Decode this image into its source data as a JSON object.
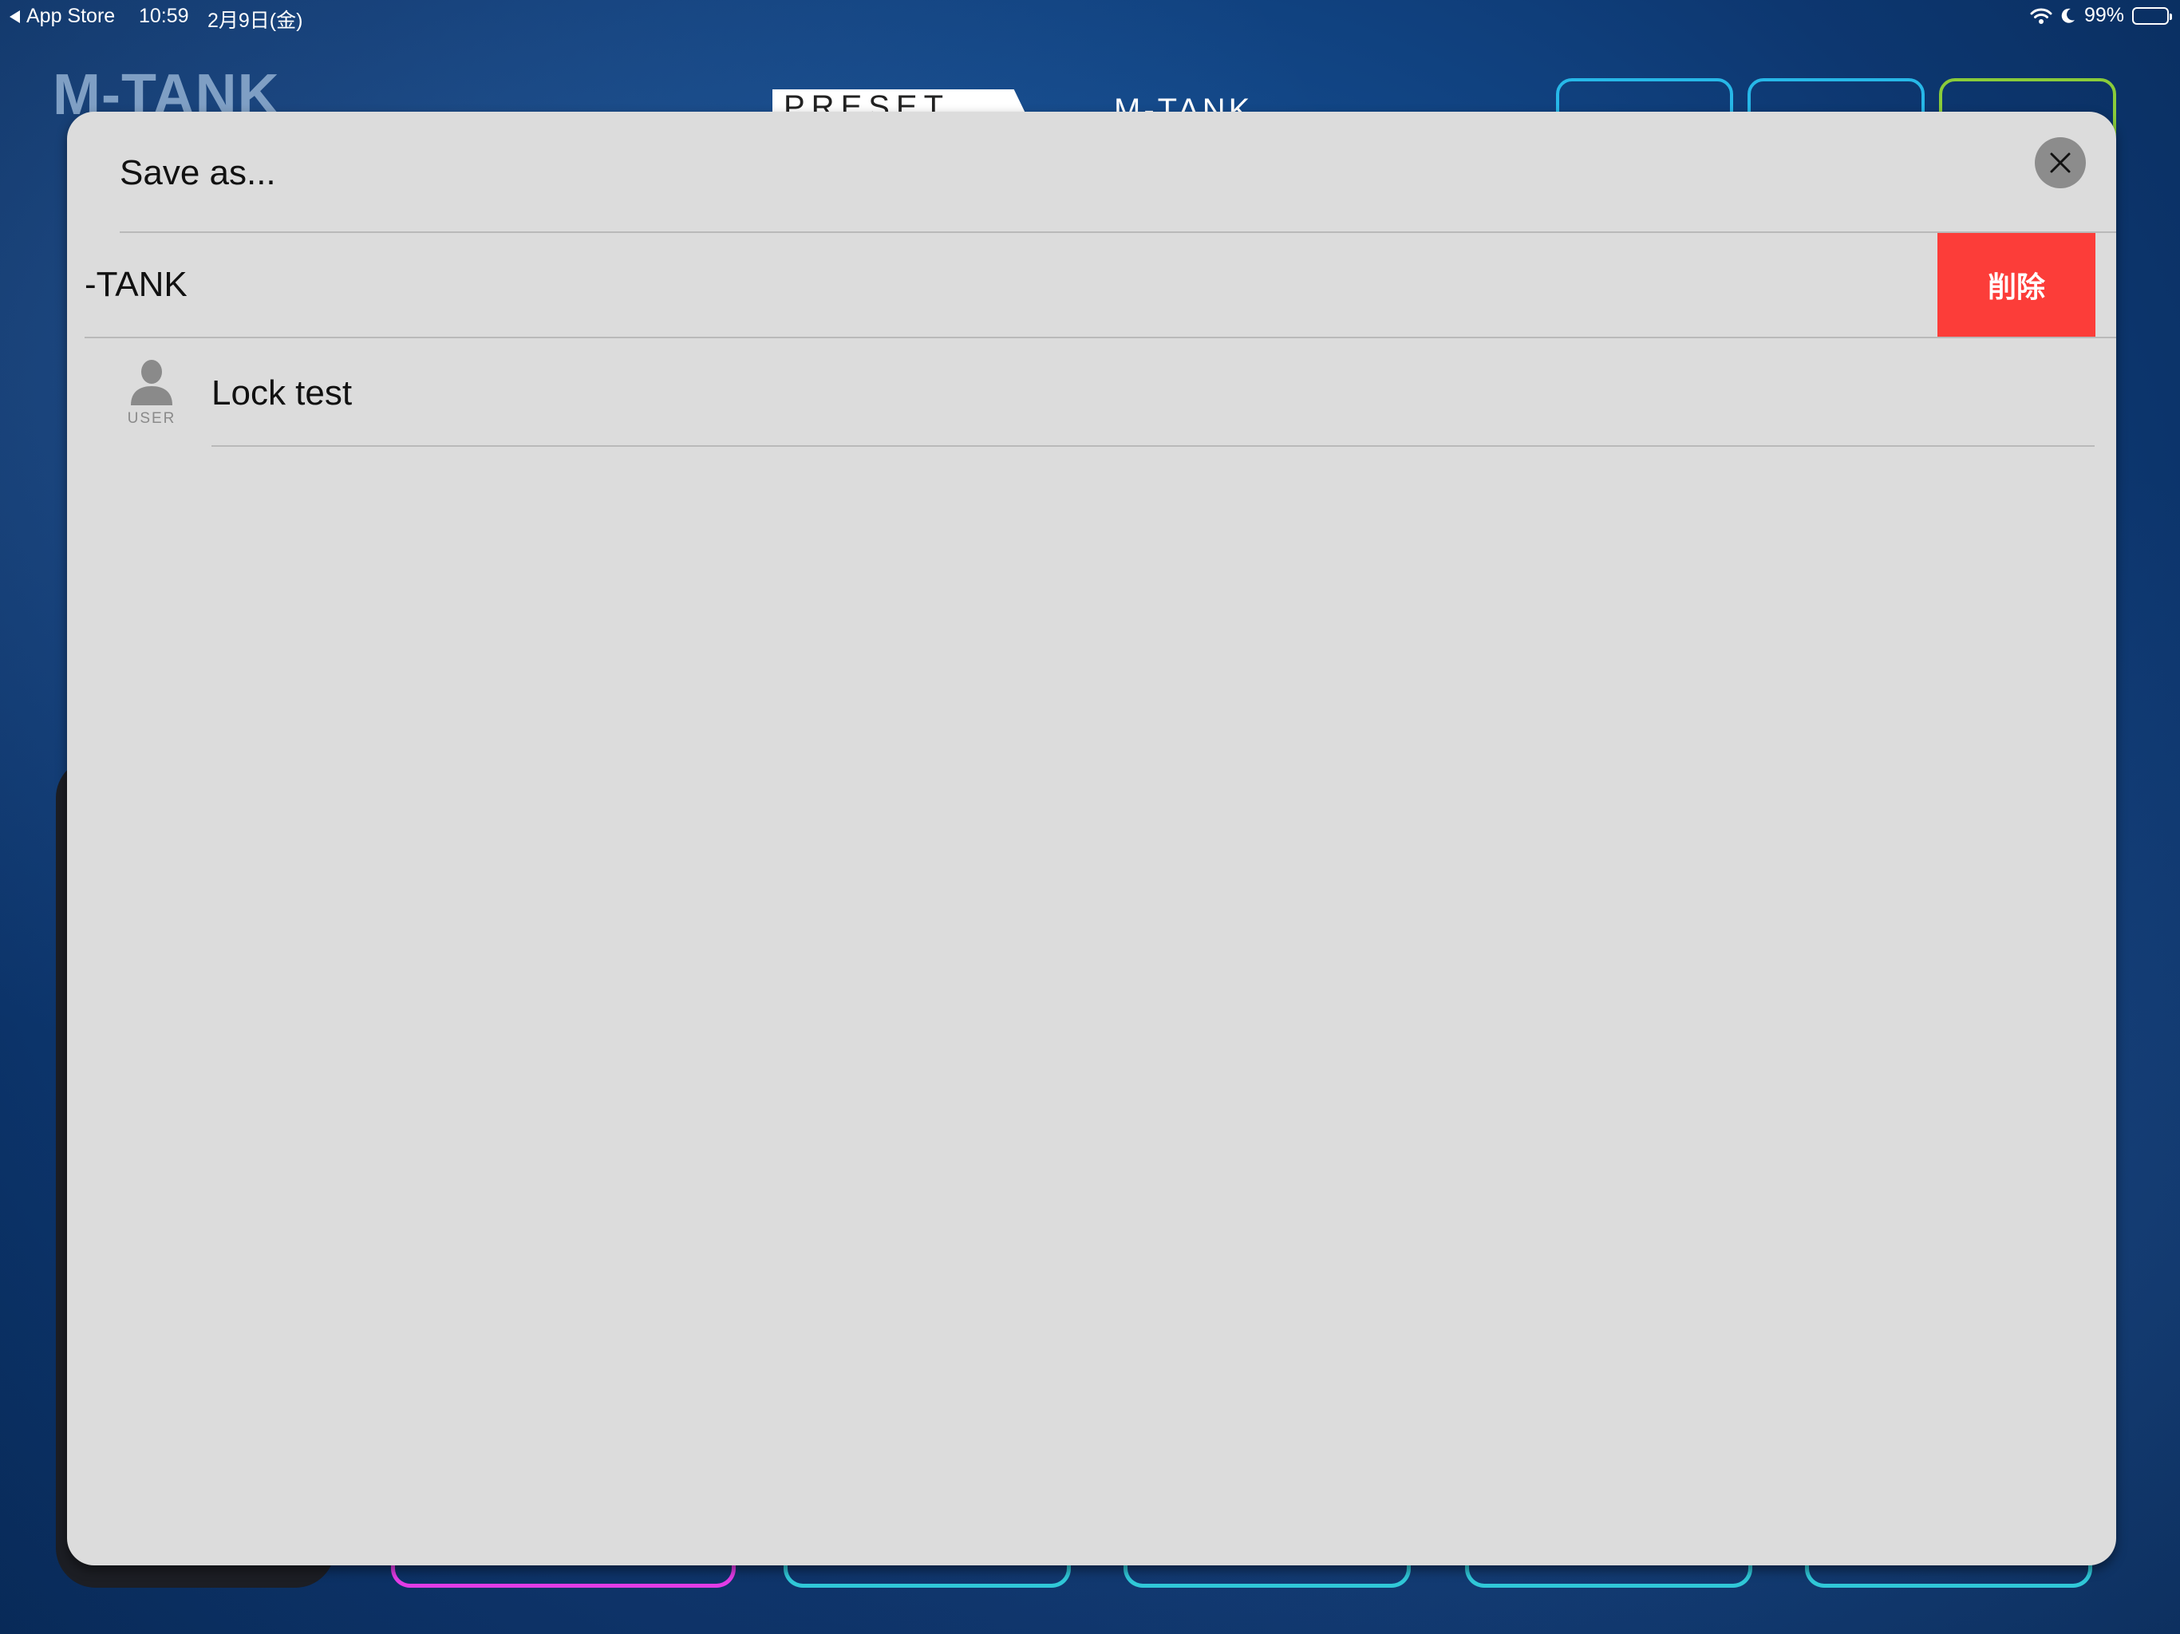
{
  "status_bar": {
    "back_label": "App Store",
    "time": "10:59",
    "date": "2月9日(金)",
    "battery": "99%",
    "battery_level": 0.99
  },
  "background_app": {
    "logo": "M-TANK",
    "tab_preset": "PRESET",
    "tab_name": "M-TANK"
  },
  "dialog": {
    "title": "Save as...",
    "close_icon": "close-icon",
    "presets": [
      {
        "name": "-TANK",
        "delete_label": "削除",
        "delete_color": "#fc3d39"
      },
      {
        "name": "Lock test",
        "badge": "USER",
        "icon": "user-icon"
      }
    ]
  }
}
